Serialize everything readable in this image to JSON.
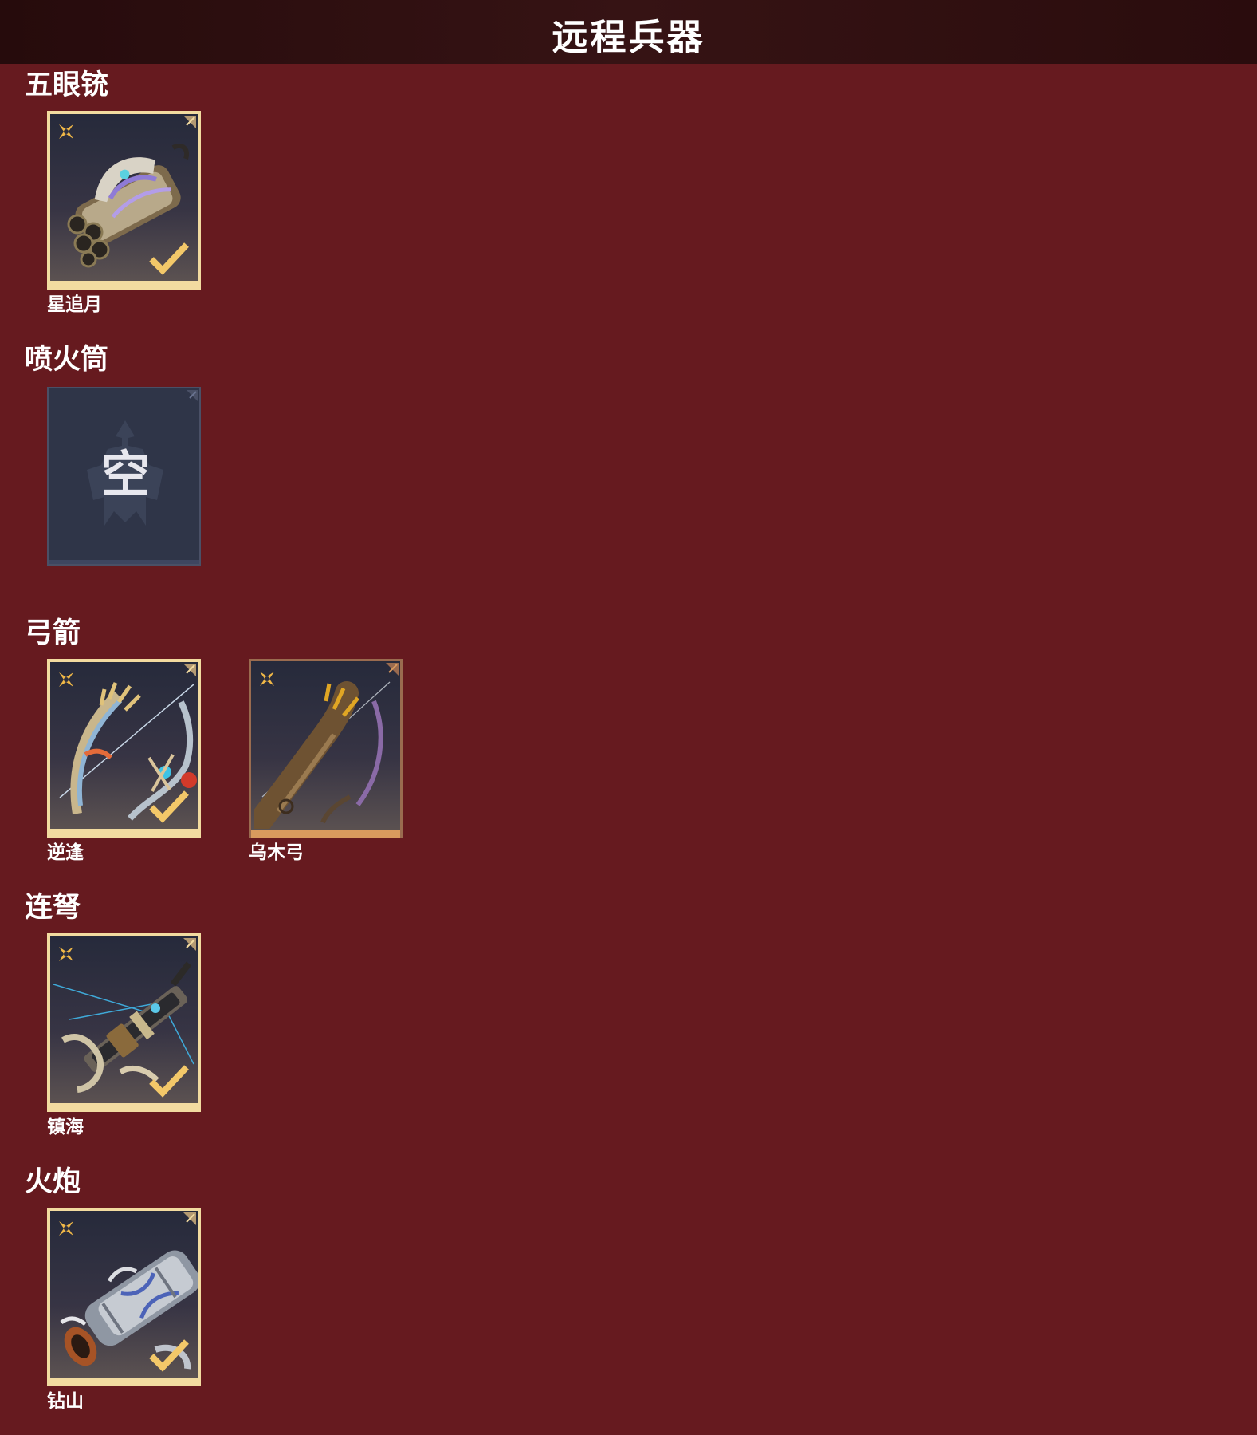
{
  "header": {
    "title": "远程兵器"
  },
  "sections": [
    {
      "title": "五眼铳",
      "items": [
        {
          "name": "星追月",
          "state": "equipped",
          "art": "five-barrel-gun-art"
        }
      ]
    },
    {
      "title": "喷火筒",
      "items": [
        {
          "name": "",
          "state": "empty",
          "empty_label": "空"
        }
      ]
    },
    {
      "title": "弓箭",
      "items": [
        {
          "name": "逆逢",
          "state": "equipped",
          "art": "ornate-bow-art"
        },
        {
          "name": "乌木弓",
          "state": "owned",
          "art": "ebony-bow-art"
        }
      ]
    },
    {
      "title": "连弩",
      "items": [
        {
          "name": "镇海",
          "state": "equipped",
          "art": "repeating-crossbow-art"
        }
      ]
    },
    {
      "title": "火炮",
      "items": [
        {
          "name": "钻山",
          "state": "equipped",
          "art": "cannon-art"
        }
      ]
    }
  ],
  "colors": {
    "background": "#661a1f",
    "header": "#2b0c0d",
    "card_border_gold": "#f2dba0",
    "card_inner": "#2f3348",
    "star_accent": "#f0b847",
    "check_accent": "#f3c869"
  }
}
